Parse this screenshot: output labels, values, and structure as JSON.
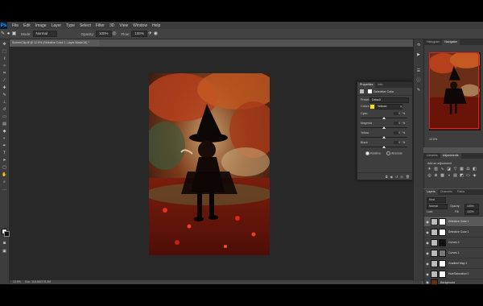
{
  "menu": [
    "File",
    "Edit",
    "Image",
    "Layer",
    "Type",
    "Select",
    "Filter",
    "3D",
    "View",
    "Window",
    "Help"
  ],
  "app_logo": "Ps",
  "options_bar": {
    "mode_label": "Mode:",
    "mode_value": "Normal",
    "opacity_label": "Opacity:",
    "opacity_value": "100%",
    "flow_label": "Flow:",
    "flow_value": "100%"
  },
  "document": {
    "tab_title": "ScreenClip.tif @ 12.5% (Selective Color 1, Layer Mask/16) *",
    "status_zoom": "12.5%",
    "status_doc": "Doc: 118.6M/178.3M"
  },
  "properties": {
    "tabs": [
      "Properties",
      "Info"
    ],
    "title": "Selective Color",
    "preset_label": "Preset:",
    "preset_value": "Default",
    "colors_label": "Colors:",
    "colors_value": "Yellows",
    "sliders": [
      {
        "label": "Cyan",
        "value": "0",
        "percent": "%",
        "level": 0.5
      },
      {
        "label": "Magenta",
        "value": "0",
        "percent": "%",
        "level": 0.5
      },
      {
        "label": "Yellow",
        "value": "0",
        "percent": "%",
        "level": 0.5
      },
      {
        "label": "Black",
        "value": "0",
        "percent": "%",
        "level": 0.5
      }
    ],
    "relative_label": "Relative",
    "absolute_label": "Absolute"
  },
  "right_panels": {
    "nav_tabs": [
      "Histogram",
      "Navigator"
    ],
    "zoom_value": "12.5%",
    "adj_tabs": [
      "Libraries",
      "Adjustments"
    ],
    "adj_hint": "Add an adjustment",
    "layers_tabs": [
      "Layers",
      "Channels",
      "Paths"
    ],
    "kind_label": "Kind",
    "blend_value": "Normal",
    "opacity_label": "Opacity:",
    "opacity_value": "100%",
    "lock_label": "Lock:",
    "fill_label": "Fill:",
    "fill_value": "100%"
  },
  "layers": [
    {
      "name": "Selective Color 1",
      "selected": true
    },
    {
      "name": "Selective Color 1",
      "selected": false
    },
    {
      "name": "Curves 2",
      "selected": false
    },
    {
      "name": "Curves 1",
      "selected": false
    },
    {
      "name": "Gradient Map 1",
      "selected": false
    },
    {
      "name": "Hue/Saturation 1",
      "selected": false
    },
    {
      "name": "Background",
      "selected": false
    }
  ],
  "colors": {
    "accent": "#31a8ff",
    "selected_layer": "#595959"
  }
}
